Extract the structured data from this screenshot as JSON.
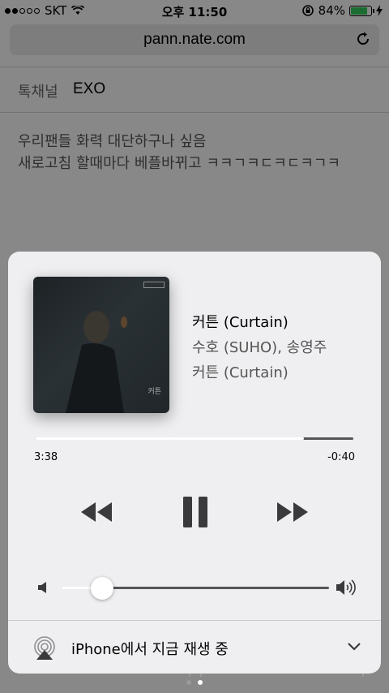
{
  "status_bar": {
    "carrier": "SKT",
    "time": "오후 11:50",
    "battery": "84%",
    "battery_level": 0.84
  },
  "browser": {
    "url": "pann.nate.com"
  },
  "page": {
    "channel_label": "톡채널",
    "channel_value": "EXO",
    "post_lines": [
      "우리팬들 화력 대단하구나 싶음",
      "새로고침 할때마다 베플바뀌고 ㅋㅋㄱㅋㄷㅋㄷㅋㄱㅋ"
    ]
  },
  "now_playing": {
    "title": "커튼 (Curtain)",
    "artist": "수호 (SUHO), 송영주",
    "album": "커튼 (Curtain)",
    "artwork_text": "커튼",
    "elapsed": "3:38",
    "remaining": "-0:40",
    "progress": 0.845,
    "volume": 0.15,
    "airplay_label": "iPhone에서 지금 재생 중"
  },
  "colors": {
    "accent_battery": "#34c759",
    "card_background": "#efeff1"
  },
  "icons": {
    "prev": "rewind-icon",
    "pause": "pause-icon",
    "next": "fast-forward-icon",
    "airplay": "airplay-icon",
    "chevron": "chevron-down-icon"
  }
}
